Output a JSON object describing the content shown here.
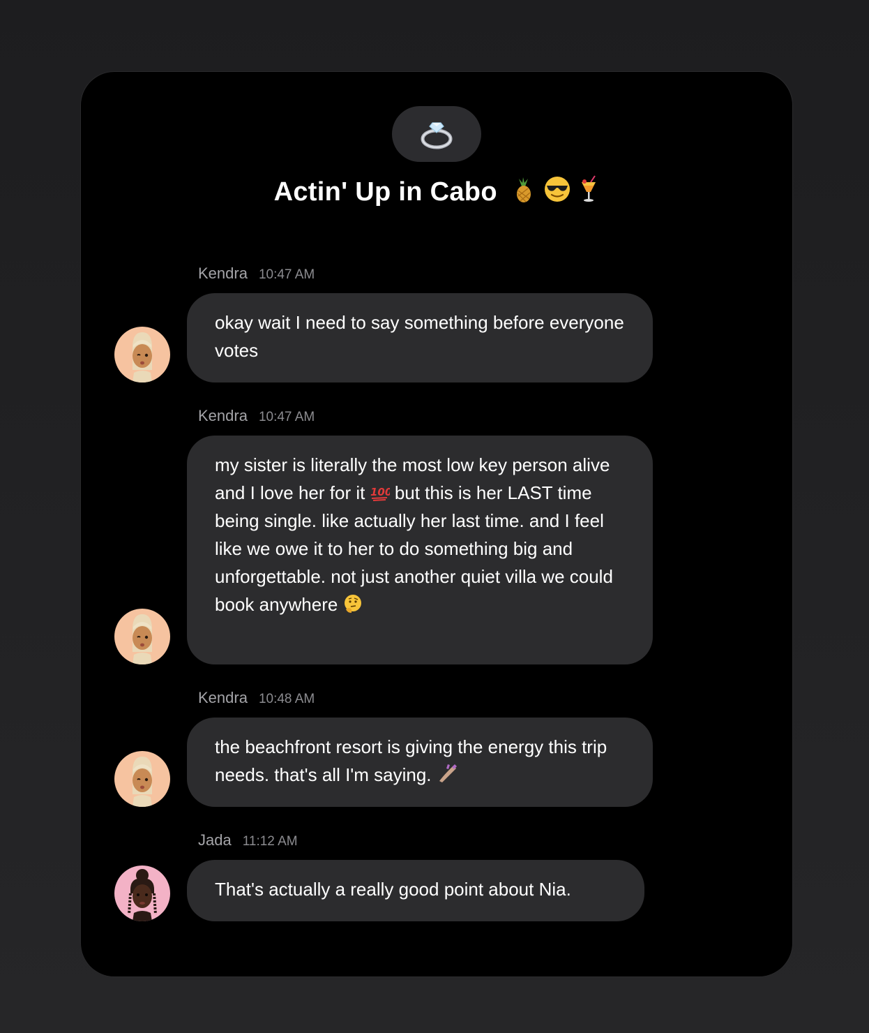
{
  "group": {
    "icon": "ring-icon",
    "title": "Actin' Up in Cabo",
    "title_emojis": [
      "pineapple-icon",
      "sunglasses-face-icon",
      "tropical-drink-icon"
    ]
  },
  "messages": [
    {
      "sender": "Kendra",
      "time": "10:47 AM",
      "avatar": "kendra-avatar",
      "text": "okay wait I need to say something before everyone votes"
    },
    {
      "sender": "Kendra",
      "time": "10:47 AM",
      "avatar": "kendra-avatar",
      "text_part1": "my sister is literally the most low key person alive and I love her for it",
      "emoji1": "hundred-points-icon",
      "text_part2": "but this is her LAST time being single. like actually her last time. and I feel like we owe it to her to do something big and unforgettable. not just another quiet villa we could book anywhere",
      "emoji2": "thinking-face-icon"
    },
    {
      "sender": "Kendra",
      "time": "10:48 AM",
      "avatar": "kendra-avatar",
      "text": "the beachfront resort is giving the energy this trip needs. that's all I'm saying.",
      "emoji": "nail-polish-icon"
    },
    {
      "sender": "Jada",
      "time": "11:12 AM",
      "avatar": "jada-avatar",
      "text": "That's actually a really good point about Nia."
    }
  ]
}
